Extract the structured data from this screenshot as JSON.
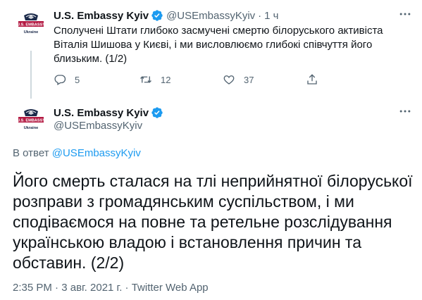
{
  "tweet1": {
    "author": "U.S. Embassy Kyiv",
    "handle": "@USEmbassyKyiv",
    "separator": "·",
    "time": "1 ч",
    "text": "Сполучені Штати глибоко засмучені смертю білоруського активіста Віталія Шишова у Києві, і ми висловлюємо глибокі співчуття його близьким. (1/2)",
    "replies": "5",
    "retweets": "12",
    "likes": "37"
  },
  "avatar": {
    "banner": "U.S. EMBASSY",
    "country": "Ukraine",
    "banner_color": "#b31942",
    "seal_color": "#1b2a4a"
  },
  "tweet2": {
    "author": "U.S. Embassy Kyiv",
    "handle": "@USEmbassyKyiv",
    "reply_prefix": "В ответ",
    "reply_handle": "@USEmbassyKyiv",
    "text": "Його смерть сталася на тлі неприйнятної білоруської розправи з громадянським суспільством, і ми сподіваємося на повне та ретельне розслідування українською владою і встановлення причин та обставин. (2/2)",
    "time": "2:35 PM",
    "date": "3 авг. 2021 г.",
    "meta_separator": "·",
    "source": "Twitter Web App"
  },
  "colors": {
    "verified": "#1d9bf0",
    "link": "#1d9bf0",
    "secondary_text": "#536471",
    "primary_text": "#0f1419",
    "thread_line": "#cfd9de"
  },
  "icons": [
    "verified-icon",
    "more-icon",
    "reply-icon",
    "retweet-icon",
    "like-icon",
    "share-icon"
  ]
}
